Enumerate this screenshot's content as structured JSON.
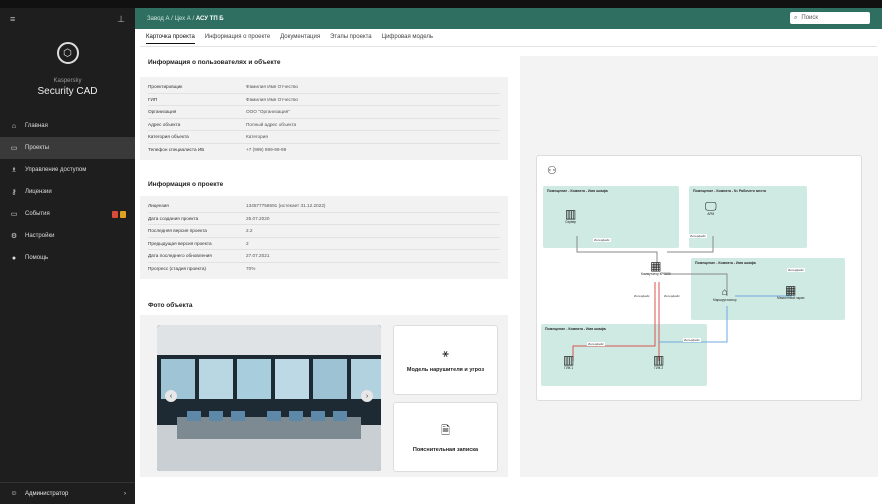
{
  "sidebar": {
    "brand_small": "Kaspersky",
    "brand_main": "Security CAD",
    "items": [
      {
        "label": "Главная",
        "icon": "home-icon",
        "glyph": "⌂"
      },
      {
        "label": "Проекты",
        "icon": "folder-icon",
        "glyph": "▭"
      },
      {
        "label": "Управление доступом",
        "icon": "users-icon",
        "glyph": "♗"
      },
      {
        "label": "Лицензии",
        "icon": "key-icon",
        "glyph": "⚷"
      },
      {
        "label": "События",
        "icon": "monitor-icon",
        "glyph": "▭"
      },
      {
        "label": "Настройки",
        "icon": "gear-icon",
        "glyph": "⚙"
      },
      {
        "label": "Помощь",
        "icon": "help-icon",
        "glyph": "●"
      }
    ],
    "active_index": 1,
    "event_badges": [
      "#d94a3a",
      "#e0a020"
    ],
    "user": "Администратор"
  },
  "header": {
    "crumb1": "Завод А",
    "sep": " / ",
    "crumb2": "Цех А",
    "crumb3": "АСУ ТП Б",
    "search_placeholder": "Поиск"
  },
  "tabs": [
    "Карточка проекта",
    "Информация о проекте",
    "Документация",
    "Этапы проекта",
    "Цифровая модель"
  ],
  "users_section": {
    "title": "Информация о пользователях и объекте",
    "rows": [
      [
        "Проектировщик",
        "Фамилия Имя Отчество"
      ],
      [
        "ГИП",
        "Фамилия Имя Отчество"
      ],
      [
        "Организация",
        "ООО \"Организация\""
      ],
      [
        "Адрес объекта",
        "Полный адрес объекта"
      ],
      [
        "Категория объекта",
        "Категория"
      ],
      [
        "Телефон специалиста ИБ",
        "+7 (999) 999-99-99"
      ]
    ]
  },
  "project_section": {
    "title": "Информация о проекте",
    "rows": [
      [
        "Лицензия",
        "134577758691 (истекает 31.12.2022)"
      ],
      [
        "Дата создания проекта",
        "25.07.2020"
      ],
      [
        "Последняя версия проекта",
        "2.2"
      ],
      [
        "Предыдущая версия проекта",
        "2"
      ],
      [
        "Дата последнего обновления",
        "27.07.2021"
      ],
      [
        "Прогресс (стадия проекта)",
        "70%"
      ]
    ]
  },
  "photo_section": {
    "title": "Фото объекта"
  },
  "cards": [
    {
      "label": "Модель нарушителя и угроз",
      "icon": "network-icon",
      "glyph": "⚹"
    },
    {
      "label": "Пояснительная записка",
      "icon": "document-icon",
      "glyph": "🗎"
    }
  ],
  "diagram": {
    "rooms": [
      "Помещение - Комната - Имя шкафа",
      "Помещение - Комната - № Рабочего места",
      "Помещение - Комната - Имя шкафа",
      "Помещение - Комната - Имя шкафа"
    ],
    "devices": [
      "Сервер",
      "АРМ",
      "Коммутатор КР6000",
      "Маршрутизатор",
      "Межсетевой экран",
      "ПЛК 1",
      "ПЛК 2"
    ],
    "link_label": "Интерфейс",
    "colors": {
      "room": "#cfeae3",
      "link_gray": "#8a8a8a",
      "link_red": "#d9534f",
      "link_blue": "#6fa8dc"
    }
  }
}
